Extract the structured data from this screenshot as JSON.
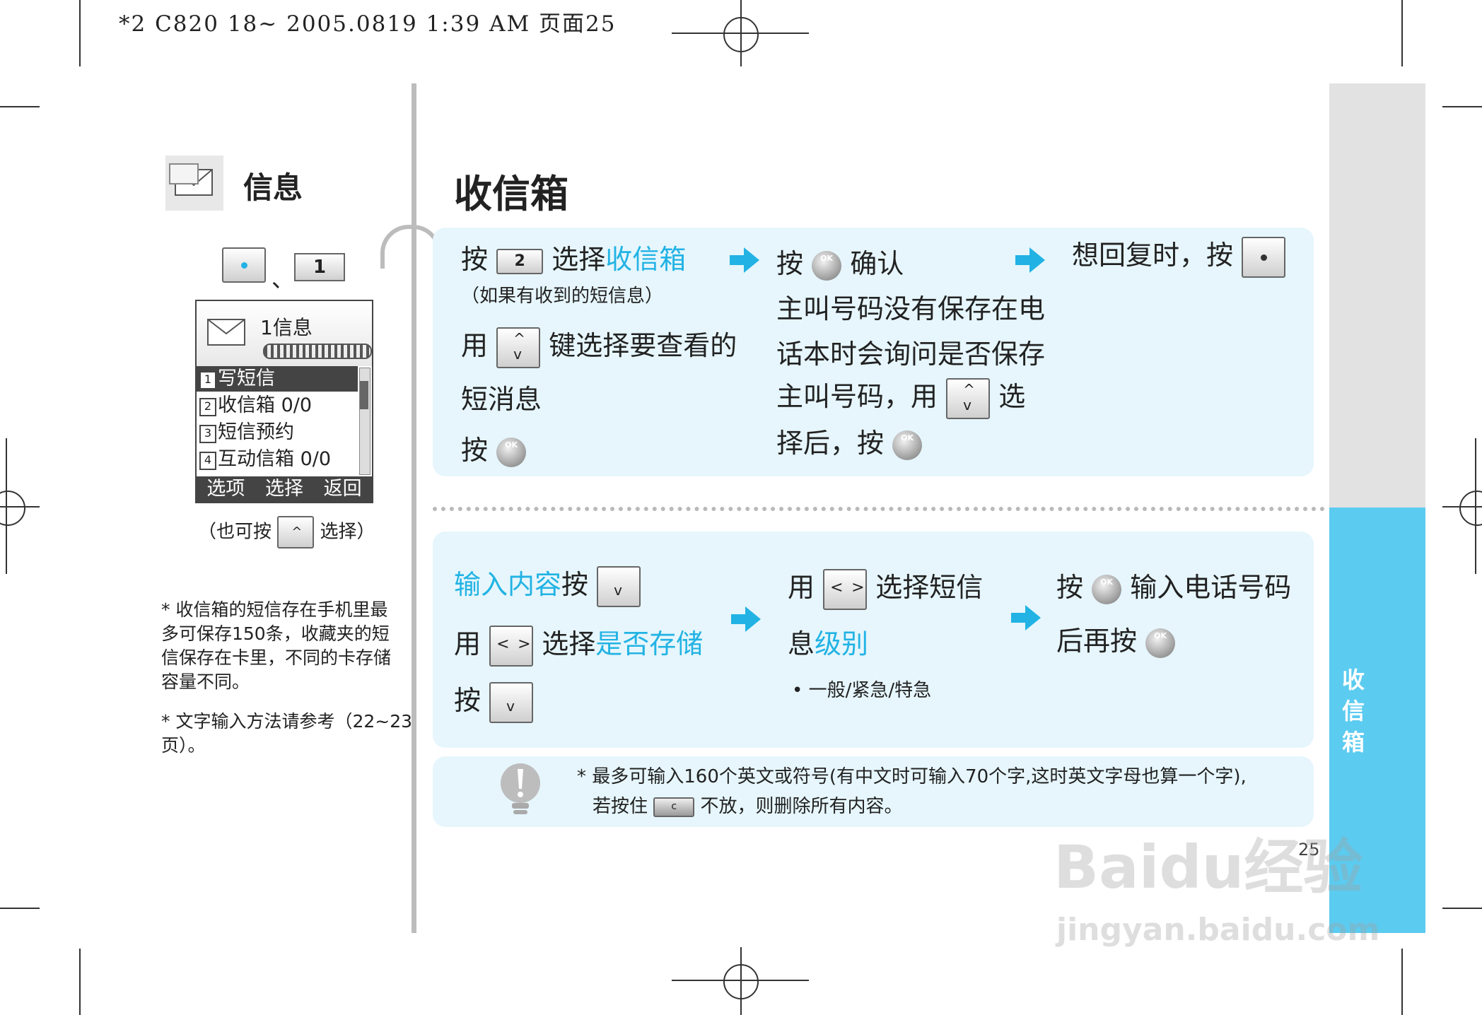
{
  "header": {
    "print_line": "*2 C820 18~ 2005.0819 1:39 AM 页面25"
  },
  "section": {
    "title": "信息"
  },
  "page": {
    "title": "收信箱",
    "number": "25",
    "tab_label": "收信箱"
  },
  "left": {
    "shortcut_sep": "、",
    "key_1_label": "1",
    "phone": {
      "header_title": "1信息",
      "items": [
        {
          "num": "1",
          "label": "写短信"
        },
        {
          "num": "2",
          "label": "收信箱 0/0"
        },
        {
          "num": "3",
          "label": "短信预约"
        },
        {
          "num": "4",
          "label": "互动信箱 0/0"
        }
      ],
      "softkeys": [
        "选项",
        "选择",
        "返回"
      ]
    },
    "also_press": {
      "before": "（也可按",
      "after": "选择）"
    },
    "notes": [
      "* 收信箱的短信存在手机里最多可保存150条，收藏夹的短信保存在卡里，不同的卡存储容量不同。",
      "* 文字输入方法请参考（22~23页）。"
    ]
  },
  "top_panel": {
    "col1": {
      "press": "按",
      "key2_label": "2",
      "select": "选择",
      "target": "收信箱",
      "paren": "（如果有收到的短信息）",
      "use": "用",
      "key_select": "键选择要查看的",
      "short_msg": "短消息",
      "press2": "按"
    },
    "col2": {
      "press": "按",
      "confirm": "确认",
      "l2": "主叫号码没有保存在电",
      "l3": "话本时会询问是否保存",
      "l4a": "主叫号码，用",
      "l4b": "选",
      "l5": "择后，按"
    },
    "col3": {
      "text": "想回复时，按"
    }
  },
  "bottom_panel": {
    "col1": {
      "input_content": "输入内容",
      "press": "按",
      "use": "用",
      "select": "选择",
      "save_q": "是否存储",
      "press2": "按"
    },
    "col2": {
      "use": "用",
      "select_msg": "选择短信",
      "info": "息",
      "level": "级别",
      "bullet": "• 一般/紧急/特急"
    },
    "col3": {
      "press": "按",
      "enter_phone": "输入电话号码",
      "then_press": "后再按"
    }
  },
  "tip": {
    "line1": "* 最多可输入160个英文或符号(有中文时可输入70个字,这时英文字母也算一个字),",
    "line2a": "若按住",
    "key_c_label": "c",
    "line2b": "不放，则删除所有内容。"
  },
  "watermark": {
    "brand": "Baidu经验",
    "url": "jingyan.baidu.com"
  },
  "colors": {
    "accent": "#22b3e4",
    "tab": "#5ccbf0",
    "panel": "#e6f6fc"
  }
}
